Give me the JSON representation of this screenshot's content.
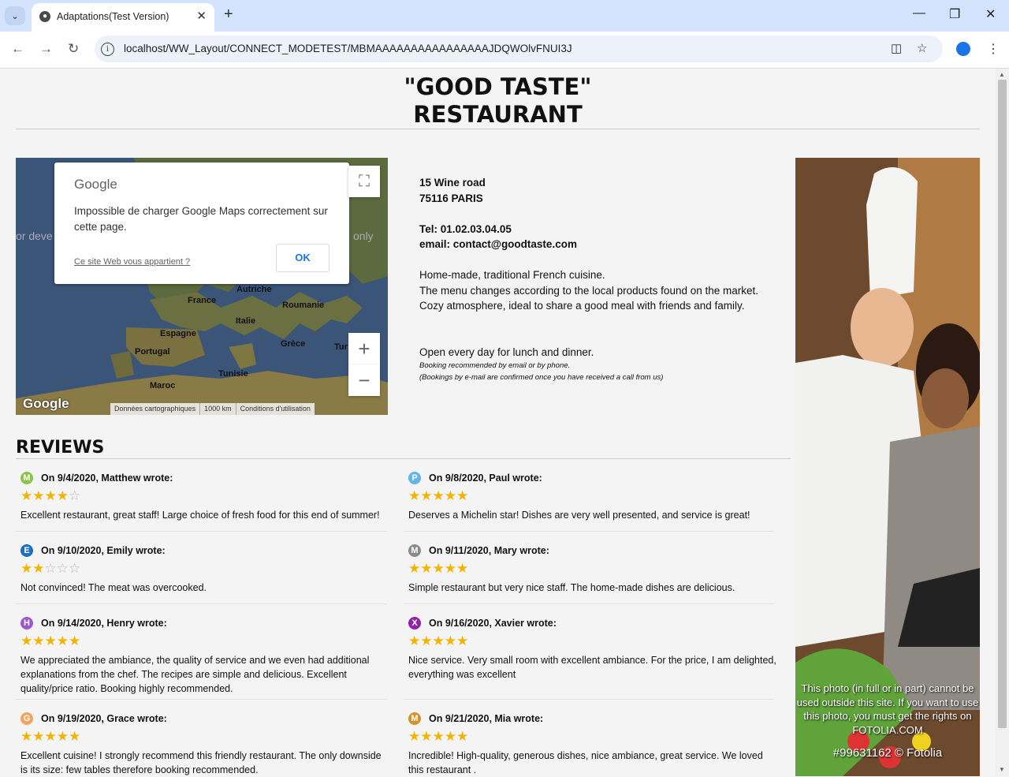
{
  "browser": {
    "tab_title": "Adaptations(Test Version)",
    "url": "localhost/WW_Layout/CONNECT_MODETEST/MBMAAAAAAAAAAAAAAAAJDQWOlvFNUI3J"
  },
  "page": {
    "title_line1": "\"GOOD TASTE\"",
    "title_line2": "RESTAURANT"
  },
  "map": {
    "dialog_brand": "Google",
    "dialog_message": "Impossible de charger Google Maps correctement sur cette page.",
    "dialog_link": "Ce site Web vous appartient ?",
    "dialog_ok": "OK",
    "labels": {
      "france": "France",
      "autriche": "Autriche",
      "roumanie": "Roumanie",
      "italie": "Italie",
      "espagne": "Espagne",
      "grece": "Grèce",
      "portugal": "Portugal",
      "tunisie": "Tunisie",
      "maroc": "Maroc",
      "tur": "Tur",
      "dev_fragment": "or deve",
      "only_fragment": "only"
    },
    "google_mark": "Google",
    "footer_data": "Données cartographiques",
    "footer_scale": "1000 km",
    "footer_terms": "Conditions d'utilisation"
  },
  "info": {
    "address1": "15 Wine road",
    "address2": "75116 PARIS",
    "tel": "Tel: 01.02.03.04.05",
    "email": "email: contact@goodtaste.com",
    "desc1": "Home-made, traditional French cuisine.",
    "desc2": "The menu changes according to the local products found on the market.",
    "desc3": "Cozy atmosphere, ideal to share a good meal with friends and family.",
    "hours": "Open every day for lunch and dinner.",
    "booking1": "Booking recommended by email or by phone.",
    "booking2": "(Bookings by e-mail are confirmed once you have received a call from us)"
  },
  "photo": {
    "caption": "This photo (in full or in part) cannot be used outside this site. If you want to use this photo, you must get the rights on FOTOLIA.COM",
    "copyright": "#99631162 © Fotolia"
  },
  "reviews": {
    "title": "REVIEWS",
    "items": [
      {
        "initial": "M",
        "color": "#8bc34a",
        "author": "On 9/4/2020, Matthew wrote:",
        "rating": 4,
        "text": "Excellent restaurant, great staff! Large choice of fresh food for this end of summer!"
      },
      {
        "initial": "P",
        "color": "#64b5e6",
        "author": "On 9/8/2020, Paul wrote:",
        "rating": 5,
        "text": "Deserves a Michelin star! Dishes are very well presented, and service is great!"
      },
      {
        "initial": "E",
        "color": "#1e6fbf",
        "author": "On 9/10/2020, Emily wrote:",
        "rating": 2,
        "text": "Not convinced! The meat was overcooked."
      },
      {
        "initial": "M",
        "color": "#8a8a8a",
        "author": "On 9/11/2020, Mary wrote:",
        "rating": 5,
        "text": "Simple restaurant but very nice staff. The home-made dishes are delicious."
      },
      {
        "initial": "H",
        "color": "#9b59d0",
        "author": "On 9/14/2020, Henry wrote:",
        "rating": 5,
        "text": "We appreciated the ambiance, the quality of service and we even had additional explanations from the chef. The recipes are simple and delicious. Excellent quality/price ratio. Booking highly recommended."
      },
      {
        "initial": "X",
        "color": "#8e24aa",
        "author": "On 9/16/2020, Xavier wrote:",
        "rating": 5,
        "text": "Nice service. Very small room with excellent ambiance. For the price, I am delighted, everything was excellent"
      },
      {
        "initial": "G",
        "color": "#f4a460",
        "author": "On 9/19/2020, Grace wrote:",
        "rating": 5,
        "text": "Excellent cuisine! I strongly recommend this friendly restaurant. The only downside is its size: few tables therefore booking recommended."
      },
      {
        "initial": "M",
        "color": "#d4922a",
        "author": "On 9/21/2020, Mia wrote:",
        "rating": 5,
        "text": "Incredible! High-quality, generous dishes, nice ambiance, great service. We loved this restaurant ."
      }
    ]
  }
}
